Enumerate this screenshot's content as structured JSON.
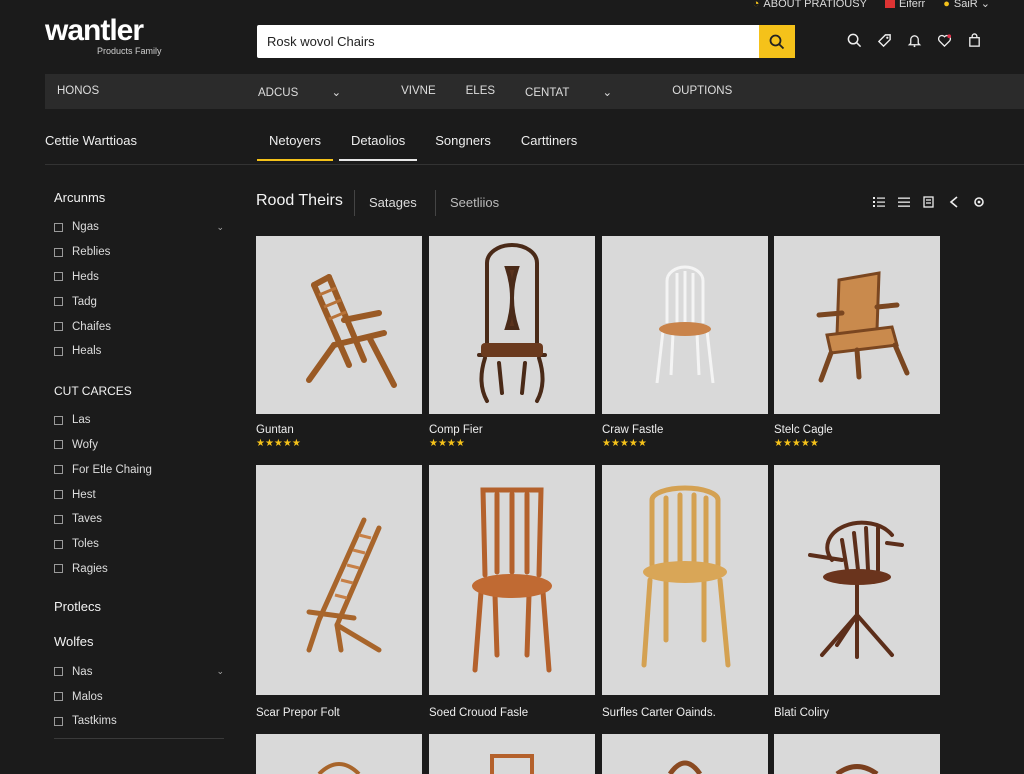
{
  "header": {
    "logo": "wantler",
    "tagline": "Products Family",
    "account_link": "ABOUT PRATIOUSY",
    "region_link": "Eiferr",
    "signin_link": "SaiR",
    "search_value": "Rosk wovol Chairs"
  },
  "icons": {
    "search": "search-icon",
    "header": [
      "search-icon",
      "tag-icon",
      "bell-icon",
      "heart-icon",
      "cart-icon"
    ],
    "view": [
      "list-icon",
      "menu-icon",
      "compare-icon",
      "share-icon",
      "settings-icon"
    ]
  },
  "colors": {
    "accent": "#f5c21a",
    "background": "#1b1b1b",
    "navbar": "#2b2b2b",
    "image_bg": "#d9d9d9"
  },
  "nav": {
    "home": "HONOS",
    "items": [
      "ADCUS",
      "VIVNE",
      "ELES",
      "CENTAT",
      "OUPTIONS"
    ]
  },
  "subbar": {
    "title": "Cettie Warttioas",
    "tabs": [
      "Netoyers",
      "Detaolios",
      "Songners",
      "Carttiners"
    ]
  },
  "sidebar": {
    "section1": {
      "title": "Arcunms",
      "items": [
        "Ngas",
        "Reblies",
        "Heds",
        "Tadg",
        "Chaifes",
        "Heals"
      ]
    },
    "section2": {
      "title": "CUT CARCES",
      "items": [
        "Las",
        "Wofy",
        "For Etle Chaing",
        "Hest",
        "Taves",
        "Toles",
        "Ragies"
      ]
    },
    "section3": {
      "title": "Protlecs"
    },
    "section4": {
      "title": "Wolfes",
      "items": [
        "Nas",
        "Malos",
        "Tastkims"
      ]
    }
  },
  "content": {
    "title": "Rood Theirs",
    "sub1": "Satages",
    "sub2": "Seetliios"
  },
  "products": [
    {
      "name": "Guntan",
      "stars": "★★★★★"
    },
    {
      "name": "Comp Fier",
      "stars": "★★★★"
    },
    {
      "name": "Craw Fastle",
      "stars": "★★★★★"
    },
    {
      "name": "Stelc Cagle",
      "stars": "★★★★★"
    },
    {
      "name": "Scar Prepor Folt",
      "stars": ""
    },
    {
      "name": "Soed Crouod Fasle",
      "stars": ""
    },
    {
      "name": "Surfles Carter Oainds.",
      "stars": ""
    },
    {
      "name": "Blati Coliry",
      "stars": ""
    }
  ]
}
